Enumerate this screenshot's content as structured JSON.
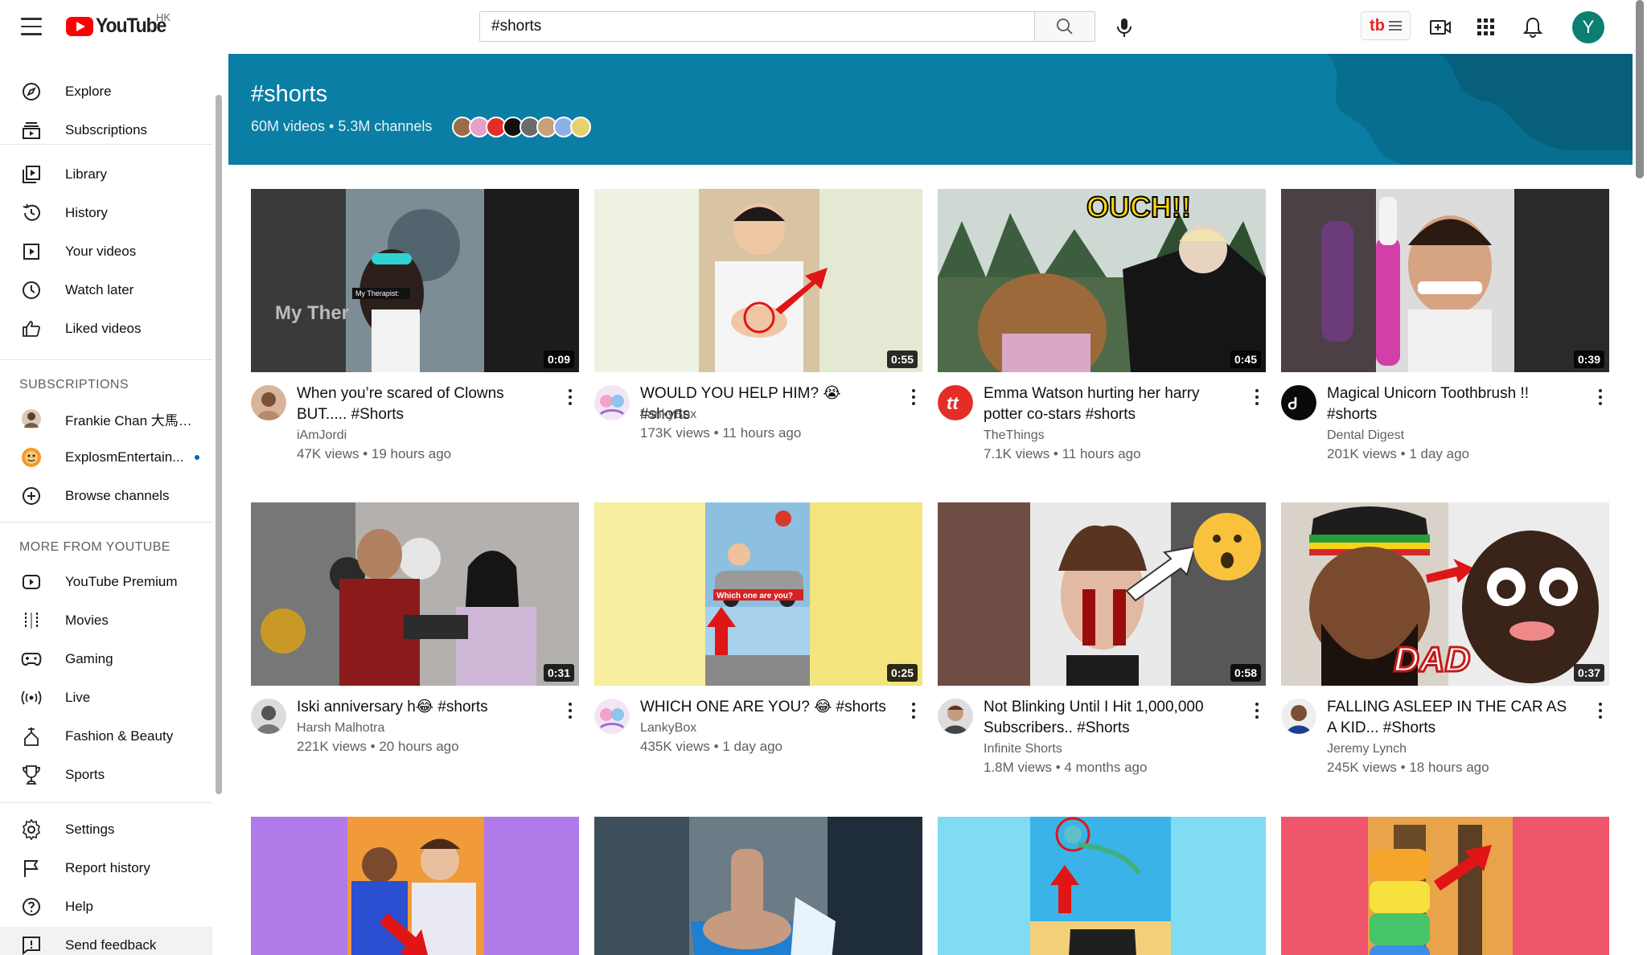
{
  "header": {
    "logo_text": "YouTube",
    "region": "HK",
    "search": {
      "value": "#shorts",
      "placeholder": "Search"
    },
    "avatar_letter": "Y",
    "icons": [
      "menu-icon",
      "search-icon",
      "mic-icon",
      "create-video-icon",
      "apps-grid-icon",
      "notifications-bell-icon"
    ]
  },
  "sidebar": {
    "main": [
      {
        "label": "Explore",
        "icon": "compass-icon"
      },
      {
        "label": "Subscriptions",
        "icon": "subscriptions-icon"
      }
    ],
    "library": [
      {
        "label": "Library",
        "icon": "library-icon"
      },
      {
        "label": "History",
        "icon": "history-icon"
      },
      {
        "label": "Your videos",
        "icon": "your-videos-icon"
      },
      {
        "label": "Watch later",
        "icon": "clock-icon"
      },
      {
        "label": "Liked videos",
        "icon": "thumbs-up-icon"
      }
    ],
    "subscriptions_heading": "SUBSCRIPTIONS",
    "subscriptions": [
      {
        "label": "Frankie Chan 大馬唔...",
        "new": false
      },
      {
        "label": "ExplosmEntertain...",
        "new": true
      },
      {
        "label": "Browse channels",
        "icon": "plus-circle-icon"
      }
    ],
    "more_heading": "MORE FROM YOUTUBE",
    "more": [
      {
        "label": "YouTube Premium",
        "icon": "premium-icon"
      },
      {
        "label": "Movies",
        "icon": "film-strip-icon"
      },
      {
        "label": "Gaming",
        "icon": "gamepad-icon"
      },
      {
        "label": "Live",
        "icon": "live-broadcast-icon"
      },
      {
        "label": "Fashion & Beauty",
        "icon": "hanger-icon"
      },
      {
        "label": "Sports",
        "icon": "trophy-icon"
      }
    ],
    "footer": [
      {
        "label": "Settings",
        "icon": "gear-icon"
      },
      {
        "label": "Report history",
        "icon": "flag-icon"
      },
      {
        "label": "Help",
        "icon": "help-circle-icon"
      },
      {
        "label": "Send feedback",
        "icon": "feedback-icon"
      }
    ]
  },
  "banner": {
    "title": "#shorts",
    "subtitle": "60M videos • 5.3M channels",
    "bg_color": "#0a7ea4"
  },
  "videos": [
    {
      "title": "When you’re scared of Clowns BUT..... #Shorts",
      "channel": "iAmJordi",
      "meta": "47K views • 19 hours ago",
      "duration": "0:09"
    },
    {
      "title": "WOULD YOU HELP HIM? 😭 #shorts",
      "channel": "LankyBox",
      "meta": "173K views • 11 hours ago",
      "duration": "0:55"
    },
    {
      "title": "Emma Watson hurting her harry potter co-stars #shorts",
      "channel": "TheThings",
      "meta": "7.1K views • 11 hours ago",
      "duration": "0:45",
      "thumb_text": "OUCH!!"
    },
    {
      "title": "Magical Unicorn Toothbrush !! #shorts",
      "channel": "Dental Digest",
      "meta": "201K views • 1 day ago",
      "duration": "0:39"
    },
    {
      "title": "Iski anniversary h😂 #shorts",
      "channel": "Harsh Malhotra",
      "meta": "221K views • 20 hours ago",
      "duration": "0:31"
    },
    {
      "title": "WHICH ONE ARE YOU? 😂 #shorts",
      "channel": "LankyBox",
      "meta": "435K views • 1 day ago",
      "duration": "0:25"
    },
    {
      "title": "Not Blinking Until I Hit 1,000,000 Subscribers.. #Shorts",
      "channel": "Infinite Shorts",
      "meta": "1.8M views • 4 months ago",
      "duration": "0:58"
    },
    {
      "title": "FALLING ASLEEP IN THE CAR AS A KID... #Shorts",
      "channel": "Jeremy Lynch",
      "meta": "245K views • 18 hours ago",
      "duration": "0:37",
      "thumb_text": "DAD"
    },
    {
      "title": "",
      "channel": "",
      "meta": "",
      "duration": ""
    },
    {
      "title": "",
      "channel": "",
      "meta": "",
      "duration": ""
    },
    {
      "title": "",
      "channel": "",
      "meta": "",
      "duration": ""
    },
    {
      "title": "",
      "channel": "",
      "meta": "",
      "duration": ""
    }
  ]
}
